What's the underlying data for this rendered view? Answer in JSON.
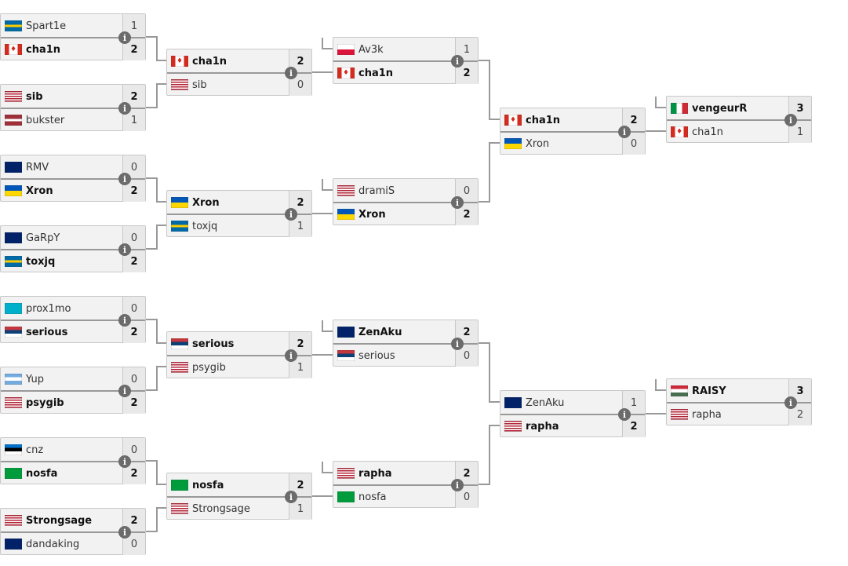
{
  "rounds": [
    [
      [
        {
          "name": "Spart1e",
          "flag": "se",
          "score": "1"
        },
        {
          "name": "cha1n",
          "flag": "ca",
          "score": "2",
          "winner": true
        }
      ],
      [
        {
          "name": "sib",
          "flag": "us",
          "score": "2",
          "winner": true
        },
        {
          "name": "bukster",
          "flag": "lv",
          "score": "1"
        }
      ],
      [
        {
          "name": "RMV",
          "flag": "gb",
          "score": "0"
        },
        {
          "name": "Xron",
          "flag": "ua",
          "score": "2",
          "winner": true
        }
      ],
      [
        {
          "name": "GaRpY",
          "flag": "gb",
          "score": "0"
        },
        {
          "name": "toxjq",
          "flag": "se",
          "score": "2",
          "winner": true
        }
      ],
      [
        {
          "name": "prox1mo",
          "flag": "kz",
          "score": "0"
        },
        {
          "name": "serious",
          "flag": "rs",
          "score": "2",
          "winner": true
        }
      ],
      [
        {
          "name": "Yup",
          "flag": "ar",
          "score": "0"
        },
        {
          "name": "psygib",
          "flag": "us",
          "score": "2",
          "winner": true
        }
      ],
      [
        {
          "name": "cnz",
          "flag": "ee",
          "score": "0"
        },
        {
          "name": "nosfa",
          "flag": "br",
          "score": "2",
          "winner": true
        }
      ],
      [
        {
          "name": "Strongsage",
          "flag": "us",
          "score": "2",
          "winner": true
        },
        {
          "name": "dandaking",
          "flag": "au",
          "score": "0"
        }
      ]
    ],
    [
      [
        {
          "name": "cha1n",
          "flag": "ca",
          "score": "2",
          "winner": true
        },
        {
          "name": "sib",
          "flag": "us",
          "score": "0"
        }
      ],
      [
        {
          "name": "Xron",
          "flag": "ua",
          "score": "2",
          "winner": true
        },
        {
          "name": "toxjq",
          "flag": "se",
          "score": "1"
        }
      ],
      [
        {
          "name": "serious",
          "flag": "rs",
          "score": "2",
          "winner": true
        },
        {
          "name": "psygib",
          "flag": "us",
          "score": "1"
        }
      ],
      [
        {
          "name": "nosfa",
          "flag": "br",
          "score": "2",
          "winner": true
        },
        {
          "name": "Strongsage",
          "flag": "us",
          "score": "1"
        }
      ]
    ],
    [
      [
        {
          "name": "Av3k",
          "flag": "pl",
          "score": "1"
        },
        {
          "name": "cha1n",
          "flag": "ca",
          "score": "2",
          "winner": true
        }
      ],
      [
        {
          "name": "dramiS",
          "flag": "us",
          "score": "0"
        },
        {
          "name": "Xron",
          "flag": "ua",
          "score": "2",
          "winner": true
        }
      ],
      [
        {
          "name": "ZenAku",
          "flag": "au",
          "score": "2",
          "winner": true
        },
        {
          "name": "serious",
          "flag": "rs",
          "score": "0"
        }
      ],
      [
        {
          "name": "rapha",
          "flag": "us",
          "score": "2",
          "winner": true
        },
        {
          "name": "nosfa",
          "flag": "br",
          "score": "0"
        }
      ]
    ],
    [
      [
        {
          "name": "cha1n",
          "flag": "ca",
          "score": "2",
          "winner": true
        },
        {
          "name": "Xron",
          "flag": "ua",
          "score": "0"
        }
      ],
      [
        {
          "name": "ZenAku",
          "flag": "au",
          "score": "1"
        },
        {
          "name": "rapha",
          "flag": "us",
          "score": "2",
          "winner": true
        }
      ]
    ],
    [
      [
        {
          "name": "vengeurR",
          "flag": "it",
          "score": "3",
          "winner": true
        },
        {
          "name": "cha1n",
          "flag": "ca",
          "score": "1"
        }
      ],
      [
        {
          "name": "RAISY",
          "flag": "hu",
          "score": "3",
          "winner": true
        },
        {
          "name": "rapha",
          "flag": "us",
          "score": "2"
        }
      ]
    ]
  ],
  "info_icon": "i"
}
